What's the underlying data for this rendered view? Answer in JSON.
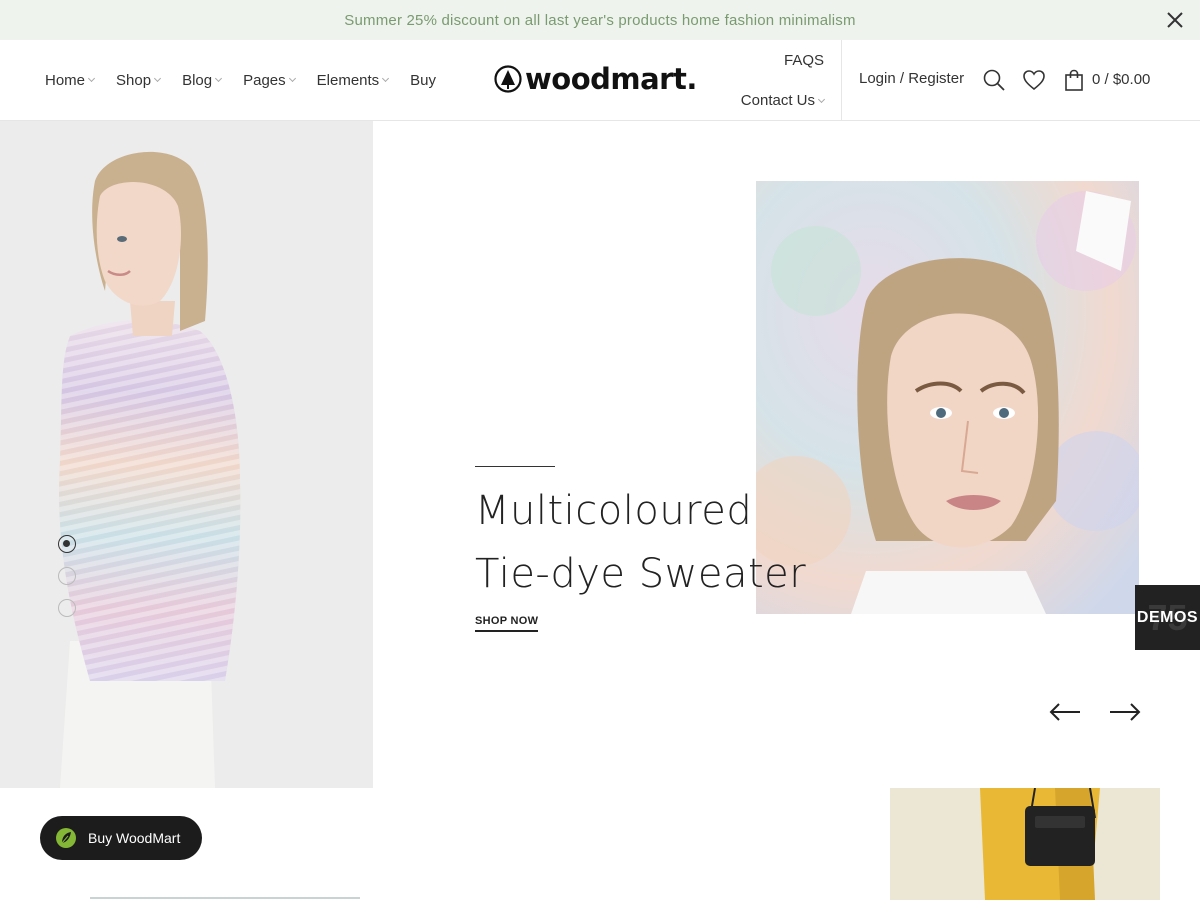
{
  "promo": {
    "text": "Summer 25% discount on all last year's products home fashion minimalism"
  },
  "nav": {
    "items": [
      {
        "label": "Home",
        "dropdown": true
      },
      {
        "label": "Shop",
        "dropdown": true
      },
      {
        "label": "Blog",
        "dropdown": true
      },
      {
        "label": "Pages",
        "dropdown": true
      },
      {
        "label": "Elements",
        "dropdown": true
      },
      {
        "label": "Buy",
        "dropdown": false
      }
    ],
    "faqs": "FAQS",
    "contact": "Contact Us"
  },
  "logo": {
    "text": "woodmart."
  },
  "account": {
    "login": "Login / Register"
  },
  "cart": {
    "count": "0",
    "separator": "/",
    "total": "$0.00",
    "display": "0 / $0.00"
  },
  "hero": {
    "title_line1": "Multicoloured",
    "title_line2": "Tie-dye Sweater",
    "cta": "SHOP NOW",
    "slides": 3,
    "active_slide": 1
  },
  "demos": {
    "label": "DEMOS",
    "count": "75"
  },
  "buy_button": {
    "label": "Buy WoodMart"
  },
  "colors": {
    "promo_bg": "#eef3ee",
    "promo_text": "#7a9b6f",
    "dark": "#1c1c1c",
    "accent_green": "#83b735"
  },
  "icons": [
    "close-icon",
    "search-icon",
    "heart-icon",
    "bag-icon",
    "arrow-left-icon",
    "arrow-right-icon",
    "leaf-icon",
    "tree-logo-icon"
  ]
}
